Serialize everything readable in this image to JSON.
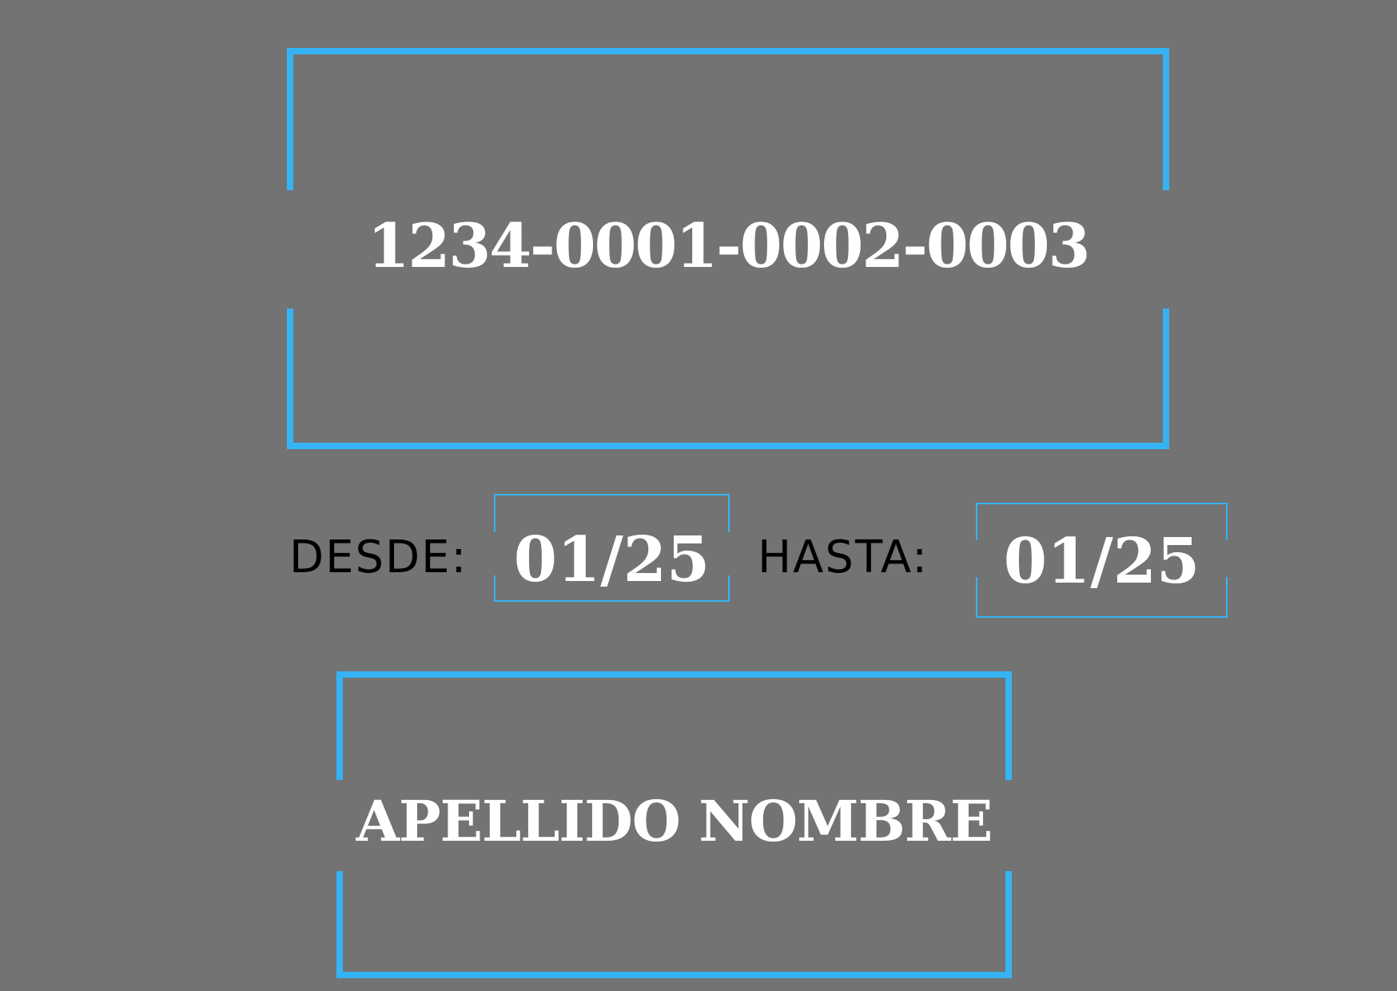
{
  "card": {
    "number": "1234-0001-0002-0003",
    "from_label": "DESDE:",
    "from_value": "01/25",
    "to_label": "HASTA:",
    "to_value": "01/25",
    "holder_name": "APELLIDO NOMBRE"
  },
  "colors": {
    "background": "#737373",
    "frame_accent": "#36b3f5",
    "text_primary": "#ffffff",
    "label_text": "#000000"
  }
}
